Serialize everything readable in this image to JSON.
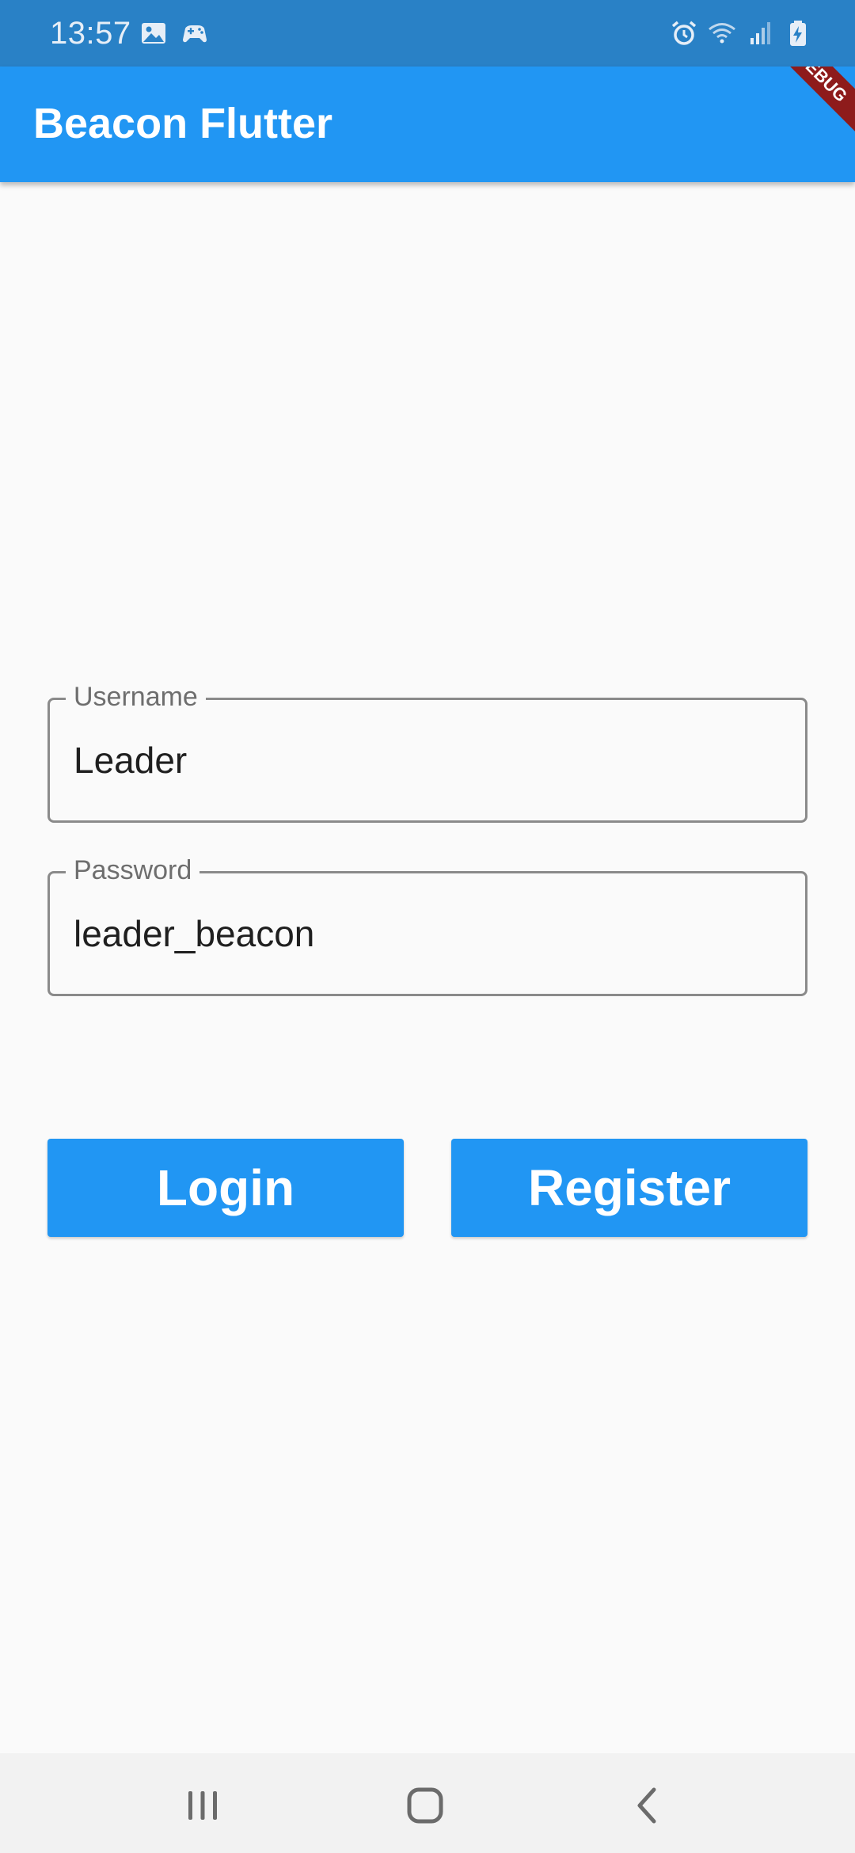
{
  "status_bar": {
    "time": "13:57",
    "left_icons": [
      "gallery-icon",
      "game-controller-icon"
    ],
    "right_icons": [
      "alarm-icon",
      "wifi-icon",
      "signal-icon",
      "battery-charging-icon"
    ]
  },
  "app_bar": {
    "title": "Beacon Flutter",
    "debug_banner": "DEBUG"
  },
  "form": {
    "username": {
      "label": "Username",
      "value": "Leader"
    },
    "password": {
      "label": "Password",
      "value": "leader_beacon"
    }
  },
  "buttons": {
    "login": "Login",
    "register": "Register"
  },
  "nav_bar": {
    "icons": [
      "recent-apps-icon",
      "home-icon",
      "back-icon"
    ]
  },
  "colors": {
    "status_bar": "#2981c6",
    "app_bar": "#2196f3",
    "button": "#2196f3",
    "background": "#fafafa",
    "debug_banner": "#8e1b1b"
  }
}
